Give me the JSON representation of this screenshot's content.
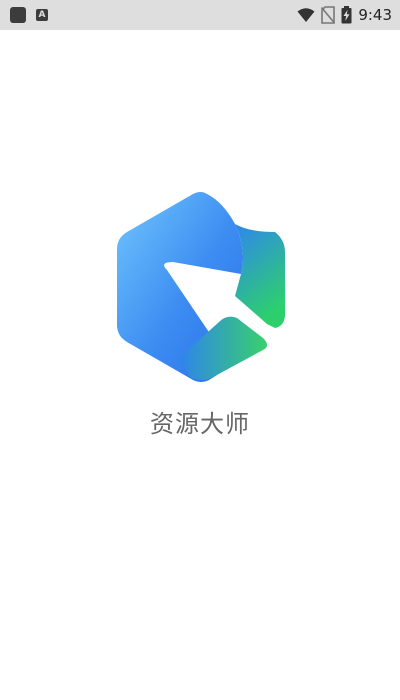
{
  "status_bar": {
    "notification_badge": "A",
    "time": "9:43"
  },
  "splash": {
    "app_name": "资源大师"
  },
  "colors": {
    "status_bar_bg": "#dedede",
    "logo_blue_light": "#6ec3fb",
    "logo_blue": "#2f7def",
    "logo_green": "#35cc70"
  }
}
